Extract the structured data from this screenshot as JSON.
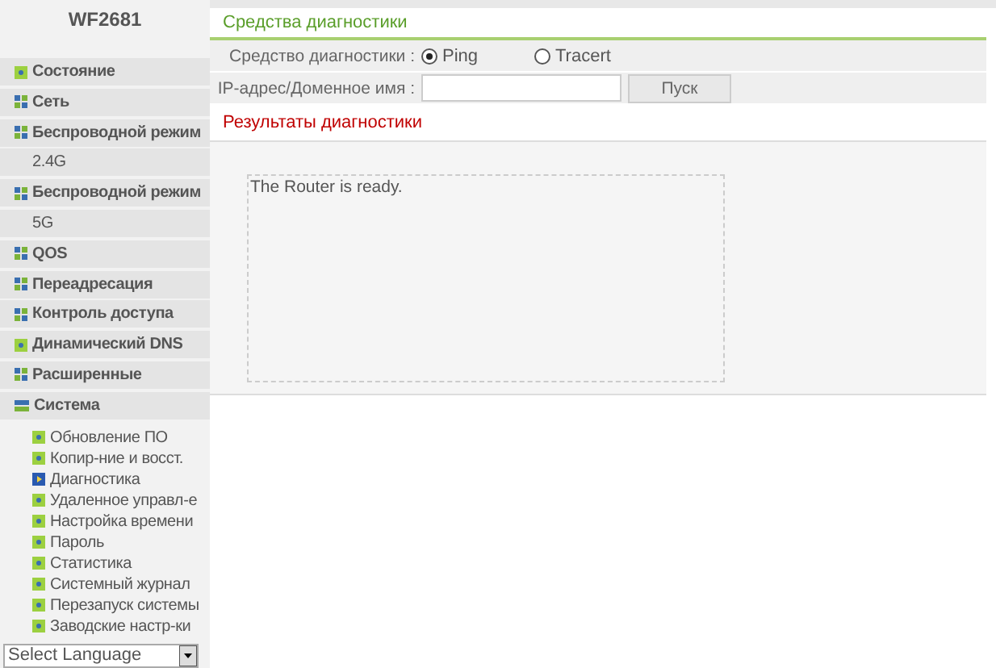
{
  "sidebar": {
    "title": "WF2681",
    "items": [
      {
        "label": "Состояние",
        "kind": "dot"
      },
      {
        "label": "Сеть",
        "kind": "grid"
      },
      {
        "label": "Беспроводной режим",
        "kind": "grid"
      },
      {
        "label": "2.4G",
        "kind": "plain"
      },
      {
        "label": "Беспроводной режим",
        "kind": "grid"
      },
      {
        "label": "5G",
        "kind": "plain"
      },
      {
        "label": "QOS",
        "kind": "grid"
      },
      {
        "label": "Переадресация",
        "kind": "grid"
      },
      {
        "label": "Контроль доступа",
        "kind": "grid"
      },
      {
        "label": "Динамический DNS",
        "kind": "dot"
      },
      {
        "label": "Расширенные",
        "kind": "grid"
      },
      {
        "label": "Система",
        "kind": "open",
        "children": [
          {
            "label": "Обновление ПО",
            "selected": false
          },
          {
            "label": "Копир-ние и восст.",
            "selected": false
          },
          {
            "label": "Диагностика",
            "selected": true
          },
          {
            "label": "Удаленное управл-е",
            "selected": false
          },
          {
            "label": "Настройка времени",
            "selected": false
          },
          {
            "label": "Пароль",
            "selected": false
          },
          {
            "label": "Статистика",
            "selected": false
          },
          {
            "label": "Системный журнал",
            "selected": false
          },
          {
            "label": "Перезапуск системы",
            "selected": false
          },
          {
            "label": "Заводские настр-ки",
            "selected": false
          }
        ]
      }
    ],
    "language": "Select Language"
  },
  "main": {
    "section_title": "Средства диагностики",
    "tool_label": "Средство диагностики :",
    "tools": [
      {
        "label": "Ping",
        "selected": true
      },
      {
        "label": "Tracert",
        "selected": false
      }
    ],
    "address_label": "IP-адрес/Доменное имя :",
    "start_button": "Пуск",
    "results_title": "Результаты диагностики",
    "output": "The Router is ready."
  }
}
